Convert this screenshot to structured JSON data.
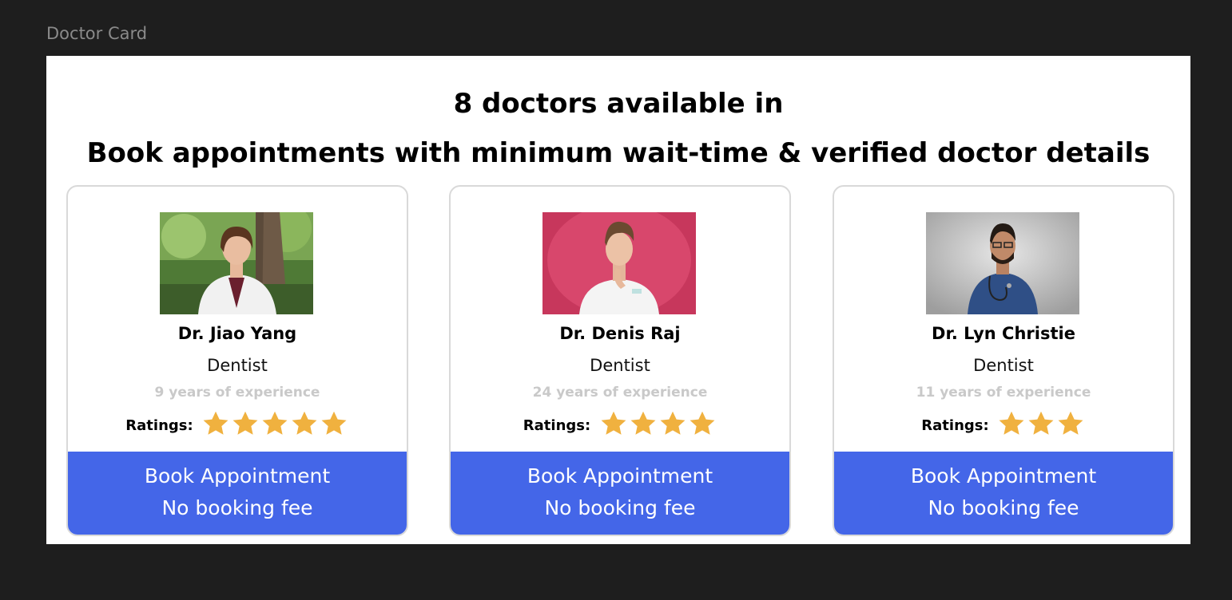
{
  "frame_label": "Doctor Card",
  "header": {
    "line1": "8 doctors available in",
    "line2": "Book appointments with minimum wait-time & verified doctor details"
  },
  "colors": {
    "accent": "#4466e8",
    "star": "#f0b13f",
    "muted": "#c9c9c9"
  },
  "doctors": [
    {
      "name": "Dr. Jiao Yang",
      "specialty": "Dentist",
      "experience": "9 years of experience",
      "ratings_label": "Ratings:",
      "rating": 5,
      "book_label": "Book Appointment",
      "fee_label": "No booking fee",
      "photo_icon": "doctor-photo-woman-white-coat"
    },
    {
      "name": "Dr. Denis Raj",
      "specialty": "Dentist",
      "experience": "24 years of experience",
      "ratings_label": "Ratings:",
      "rating": 4,
      "book_label": "Book Appointment",
      "fee_label": "No booking fee",
      "photo_icon": "doctor-photo-man-pink-background"
    },
    {
      "name": "Dr. Lyn Christie",
      "specialty": "Dentist",
      "experience": "11 years of experience",
      "ratings_label": "Ratings:",
      "rating": 3,
      "book_label": "Book Appointment",
      "fee_label": "No booking fee",
      "photo_icon": "doctor-photo-man-stethoscope"
    }
  ]
}
